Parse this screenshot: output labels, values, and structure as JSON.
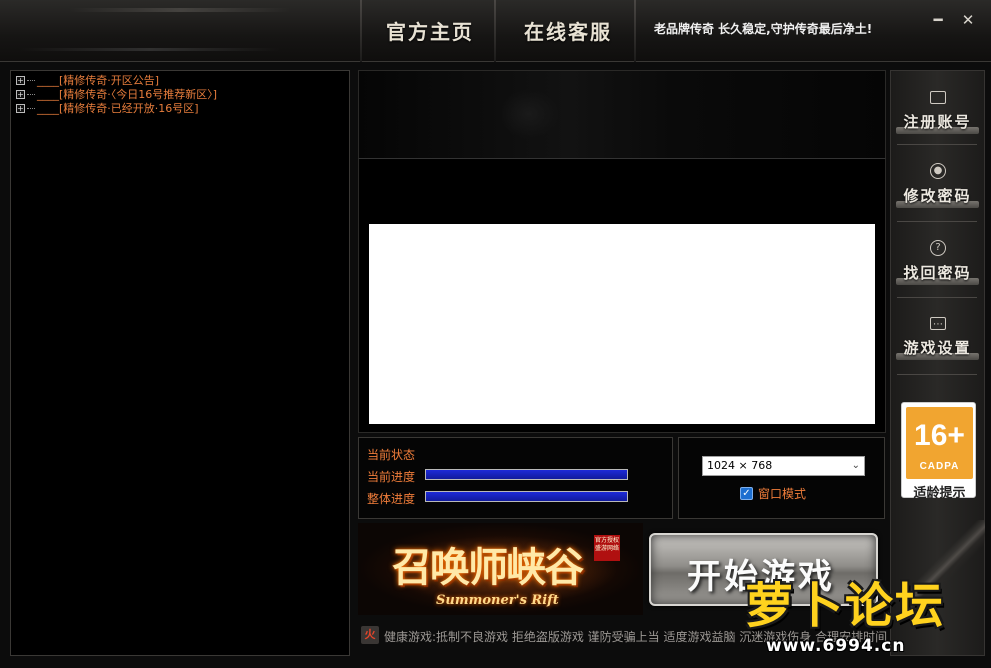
{
  "header": {
    "home_label": "官方主页",
    "support_label": "在线客服",
    "slogan": "老品牌传奇  长久稳定,守护传奇最后净土!",
    "minimize_symbol": "━",
    "settings_symbol": "✕"
  },
  "tree": {
    "items": [
      {
        "label": "____[精修传奇·开区公告]",
        "expander": "+"
      },
      {
        "label": "____[精修传奇·〈今日16号推荐新区〉]",
        "expander": "+"
      },
      {
        "label": "____[精修传奇·已经开放·16号区]",
        "expander": "+"
      }
    ]
  },
  "status": {
    "title": "当前状态",
    "current_label": "当前进度",
    "overall_label": "整体进度",
    "current_progress": 100,
    "overall_progress": 100
  },
  "resolution": {
    "selected": "1024 × 768",
    "window_mode_label": "窗口模式",
    "window_mode_checked": true
  },
  "logo": {
    "title": "召唤师峡谷",
    "subtitle": "Summoner's Rift",
    "seal_text": "官方授权 盛游网络"
  },
  "start_button": {
    "label": "开始游戏"
  },
  "notice": {
    "icon_text": "火",
    "text": "健康游戏:抵制不良游戏  拒绝盗版游戏  谨防受骗上当  适度游戏益脑  沉迷游戏伤身  合理安排时间  享受健康生活"
  },
  "sidebar": {
    "items": [
      {
        "label": "注册账号",
        "icon": "monitor-icon"
      },
      {
        "label": "修改密码",
        "icon": "user-icon"
      },
      {
        "label": "找回密码",
        "icon": "question-icon"
      },
      {
        "label": "游戏设置",
        "icon": "chat-icon"
      }
    ]
  },
  "age_rating": {
    "number": "16+",
    "org": "CADPA",
    "label": "适龄提示"
  },
  "watermark": {
    "title": "萝卜论坛",
    "url": "www.6994.cn"
  },
  "colors": {
    "accent_orange": "#f07d3a",
    "progress_blue": "#1d2ad8",
    "age_orange": "#f1a530"
  }
}
